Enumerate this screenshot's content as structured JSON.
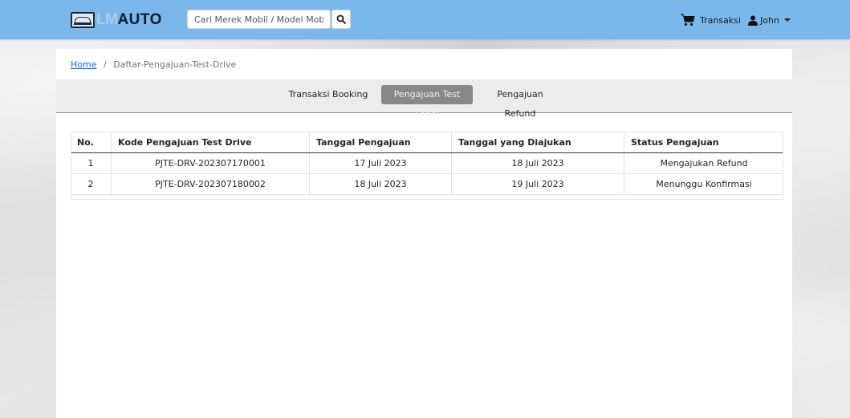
{
  "brand": {
    "lm": "LM",
    "auto": "AUTO"
  },
  "search": {
    "placeholder": "Cari Merek Mobil / Model Mobil"
  },
  "nav": {
    "cart_label": "Transaksi",
    "user_label": "John"
  },
  "breadcrumb": {
    "home": "Home",
    "separator": "/",
    "current": "Daftar-Pengajuan-Test-Drive"
  },
  "tabs": [
    {
      "label": "Transaksi Booking",
      "active": false
    },
    {
      "label": "Pengajuan Test Drive",
      "active": true
    },
    {
      "label": "Pengajuan Refund",
      "active": false
    }
  ],
  "table": {
    "headers": [
      "No.",
      "Kode Pengajuan Test Drive",
      "Tanggal Pengajuan",
      "Tanggal yang Diajukan",
      "Status Pengajuan"
    ],
    "rows": [
      [
        "1",
        "PJTE-DRV-202307170001",
        "17 Juli 2023",
        "18 Juli 2023",
        "Mengajukan Refund"
      ],
      [
        "2",
        "PJTE-DRV-202307180002",
        "18 Juli 2023",
        "19 Juli 2023",
        "Menunggu Konfirmasi"
      ]
    ]
  },
  "colors": {
    "navbar": "#7ab8ec",
    "active_tab": "#888888",
    "link": "#0d6efd"
  },
  "icons": {
    "search": "search-icon",
    "cart": "cart-icon",
    "user": "user-icon",
    "caret": "caret-down-icon",
    "logo": "car-logo-icon"
  }
}
